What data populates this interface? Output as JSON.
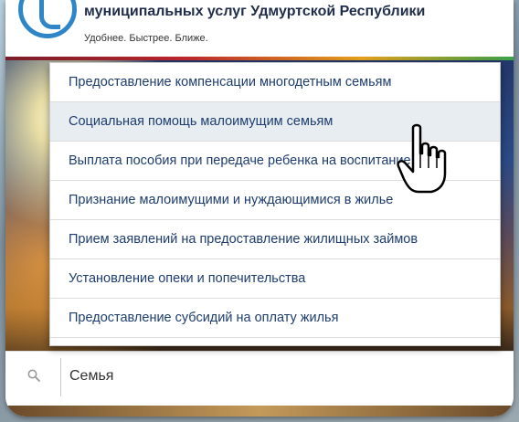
{
  "header": {
    "title": "муниципальных услуг Удмуртской Республики",
    "slogan": "Удобнее. Быстрее. Ближе."
  },
  "dropdown": {
    "items": [
      "Предоставление компенсации многодетным семьям",
      "Социальная помощь малоимущим семьям",
      "Выплата пособия при передаче ребенка на воспитание",
      "Признание малоимущими и нуждающимися в жилье",
      "Прием заявлений на предоставление жилищных займов",
      "Установление опеки и попечительства",
      "Предоставление субсидий на оплату жилья"
    ],
    "hovered_index": 1
  },
  "search": {
    "value": "Семья",
    "icon": "search-icon"
  },
  "cursor": {
    "icon": "hand-pointer-icon"
  },
  "colors": {
    "link": "#1c3d6e",
    "hover_bg": "#e8edf2",
    "logo": "#2e86c8"
  }
}
